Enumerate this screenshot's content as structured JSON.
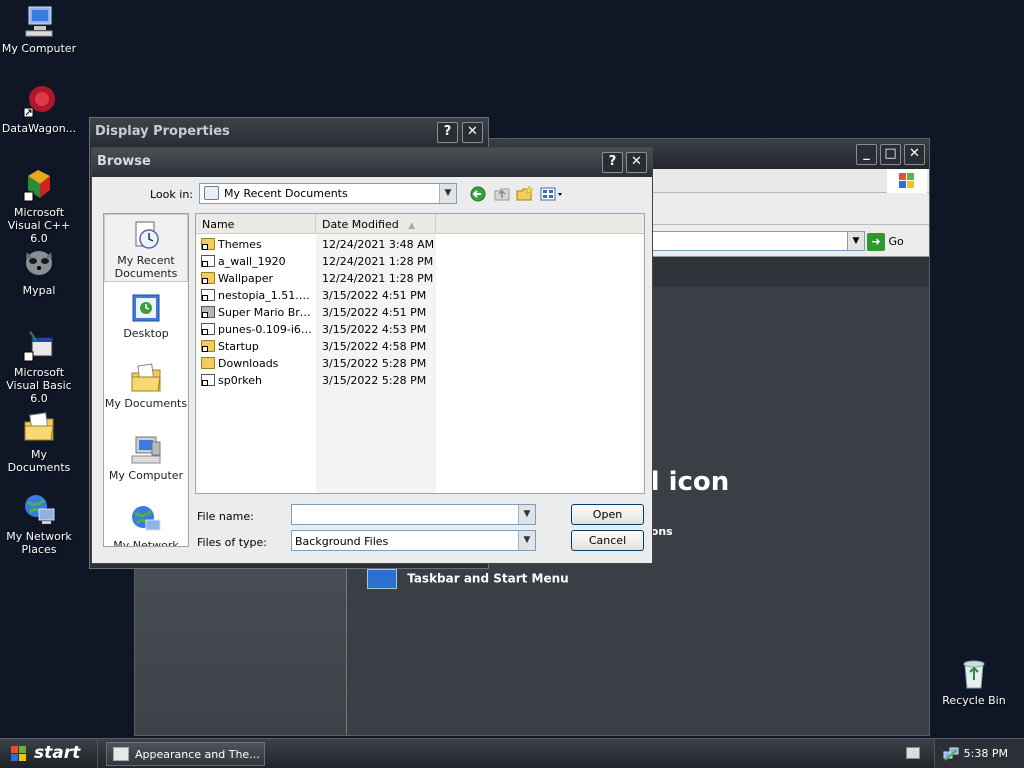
{
  "desktop": {
    "icons": [
      {
        "label": "My Computer"
      },
      {
        "label": "DataWagon..."
      },
      {
        "label": "Microsoft Visual C++ 6.0"
      },
      {
        "label": "Mypal"
      },
      {
        "label": "Microsoft Visual Basic 6.0"
      },
      {
        "label": "My Documents"
      },
      {
        "label": "My Network Places"
      },
      {
        "label": "Recycle Bin"
      }
    ]
  },
  "control_panel": {
    "go_label": "Go",
    "big_title": "el icon",
    "options_label": "ions",
    "task_label": "Taskbar and Start Menu"
  },
  "display_properties": {
    "title": "Display Properties",
    "help_btn": "?",
    "close_btn": "✕"
  },
  "browse": {
    "title": "Browse",
    "help_btn": "?",
    "close_btn": "✕",
    "look_in_label": "Look in:",
    "look_in_value": "My Recent Documents",
    "places": [
      {
        "label": "My Recent Documents"
      },
      {
        "label": "Desktop"
      },
      {
        "label": "My Documents"
      },
      {
        "label": "My Computer"
      },
      {
        "label": "My Network"
      }
    ],
    "columns": {
      "name": "Name",
      "date": "Date Modified"
    },
    "files": [
      {
        "name": "Themes",
        "date": "12/24/2021 3:48 AM"
      },
      {
        "name": "a_wall_1920",
        "date": "12/24/2021 1:28 PM"
      },
      {
        "name": "Wallpaper",
        "date": "12/24/2021 1:28 PM"
      },
      {
        "name": "nestopia_1.51.1-...",
        "date": "3/15/2022 4:51 PM"
      },
      {
        "name": "Super Mario Bros....",
        "date": "3/15/2022 4:51 PM"
      },
      {
        "name": "punes-0.109-i68...",
        "date": "3/15/2022 4:53 PM"
      },
      {
        "name": "Startup",
        "date": "3/15/2022 4:58 PM"
      },
      {
        "name": "Downloads",
        "date": "3/15/2022 5:28 PM"
      },
      {
        "name": "sp0rkeh",
        "date": "3/15/2022 5:28 PM"
      }
    ],
    "file_name_label": "File name:",
    "file_name_value": "",
    "files_of_type_label": "Files of type:",
    "files_of_type_value": "Background Files",
    "open_label": "Open",
    "cancel_label": "Cancel"
  },
  "taskbar": {
    "start_label": "start",
    "task_item": "Appearance and The...",
    "clock": "5:38 PM"
  }
}
